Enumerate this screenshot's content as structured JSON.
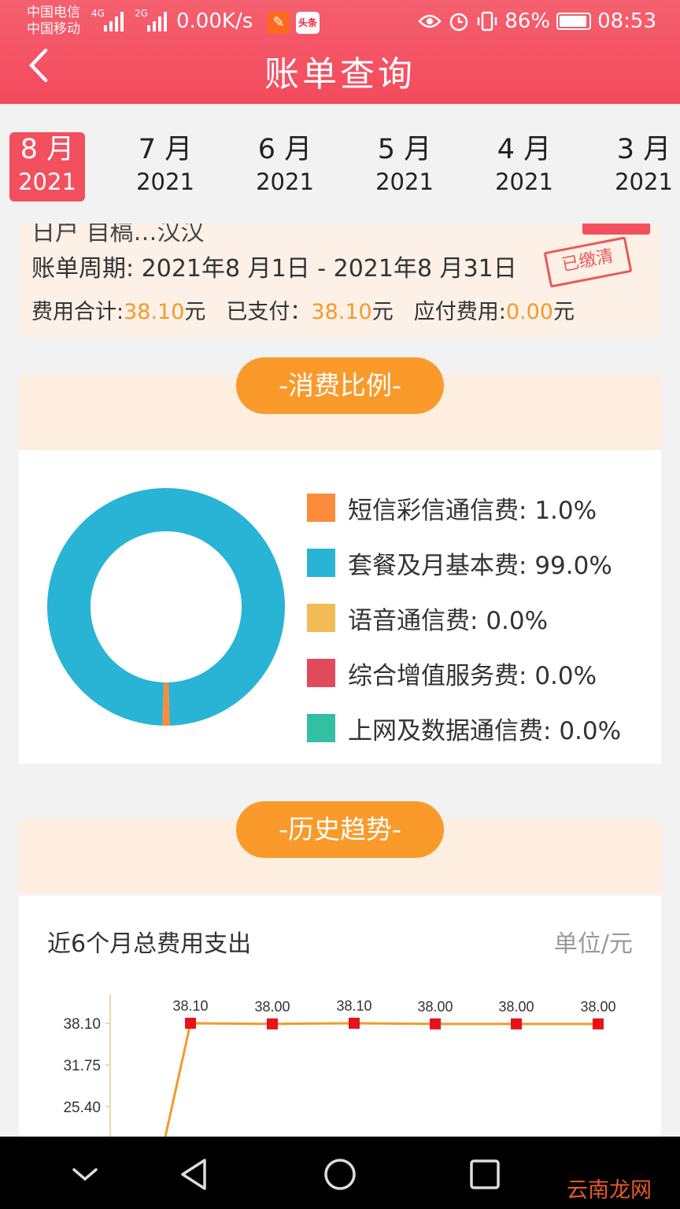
{
  "status_bar": {
    "carrier1": "中国电信",
    "carrier2": "中国移动",
    "net1": "4G",
    "net2": "2G",
    "speed": "0.00K/s",
    "app_badge": "头条",
    "battery": "86%",
    "time": "08:53"
  },
  "header": {
    "title": "账单查询"
  },
  "months": [
    {
      "month": "8 月",
      "year": "2021",
      "active": true
    },
    {
      "month": "7 月",
      "year": "2021",
      "active": false
    },
    {
      "month": "6 月",
      "year": "2021",
      "active": false
    },
    {
      "month": "5 月",
      "year": "2021",
      "active": false
    },
    {
      "month": "4 月",
      "year": "2021",
      "active": false
    },
    {
      "month": "3 月",
      "year": "2021",
      "active": false
    }
  ],
  "bill": {
    "period_label": "账单周期:",
    "period_value": "2021年8 月1日 - 2021年8 月31日",
    "stamp": "已缴清",
    "total_label": "费用合计:",
    "total_value": "38.10",
    "paid_label": "已支付：",
    "paid_value": "38.10",
    "due_label": "应付费用:",
    "due_value": "0.00",
    "currency": "元"
  },
  "ratio_section": {
    "title": "-消费比例-",
    "items": [
      {
        "label": "短信彩信通信费:",
        "percent": "1.0%",
        "value": 1.0,
        "color": "#fb8c3c"
      },
      {
        "label": "套餐及月基本费:",
        "percent": "99.0%",
        "value": 99.0,
        "color": "#29b4d6"
      },
      {
        "label": "语音通信费:",
        "percent": "0.0%",
        "value": 0.0,
        "color": "#f2bb55"
      },
      {
        "label": "综合增值服务费:",
        "percent": "0.0%",
        "value": 0.0,
        "color": "#e04b5c"
      },
      {
        "label": "上网及数据通信费:",
        "percent": "0.0%",
        "value": 0.0,
        "color": "#33bfa1"
      }
    ]
  },
  "trend_section": {
    "title": "-历史趋势-",
    "chart_title": "近6个月总费用支出",
    "unit": "单位/元"
  },
  "chart_data": {
    "type": "line",
    "title": "近6个月总费用支出",
    "unit": "单位/元",
    "y_ticks": [
      "38.10",
      "31.75",
      "25.40"
    ],
    "points": [
      {
        "value": 38.1,
        "label": "38.10"
      },
      {
        "value": 38.0,
        "label": "38.00"
      },
      {
        "value": 38.1,
        "label": "38.10"
      },
      {
        "value": 38.0,
        "label": "38.00"
      },
      {
        "value": 38.0,
        "label": "38.00"
      },
      {
        "value": 38.0,
        "label": "38.00"
      }
    ],
    "line_color": "#f39a2c",
    "marker_color": "#e8121b"
  },
  "watermark": "云南龙网"
}
